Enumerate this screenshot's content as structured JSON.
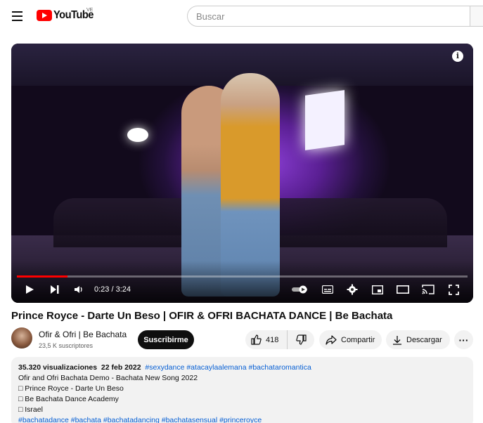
{
  "header": {
    "logo_text": "YouTube",
    "country_code": "VE",
    "search_placeholder": "Buscar"
  },
  "player": {
    "current_time": "0:23",
    "duration": "3:24",
    "time_display": "0:23 / 3:24",
    "progress_fraction": 0.113,
    "info_glyph": "i"
  },
  "video": {
    "title": "Prince Royce - Darte Un Beso | OFIR & OFRI BACHATA DANCE | Be Bachata"
  },
  "channel": {
    "name": "Ofir & Ofri | Be Bachata",
    "subscribers": "23,5 K suscriptores",
    "subscribe_label": "Suscribirme"
  },
  "actions": {
    "like_count": "418",
    "share_label": "Compartir",
    "download_label": "Descargar",
    "more_glyph": "···"
  },
  "description": {
    "views": "35.320 visualizaciones",
    "date": "22 feb 2022",
    "tags": "#sexydance #atacaylaalemana #bachataromantica",
    "lines": [
      "Ofir and Ofri Bachata Demo - Bachata New Song 2022",
      "□ Prince Royce - Darte Un Beso",
      "□ Be Bachata Dance Academy",
      "□ Israel"
    ],
    "bottom_tags": "#bachatadance  #bachata #bachatadancing  #bachatasensual #princeroyce"
  },
  "icons": [
    "menu-icon",
    "youtube-logo-icon",
    "info-icon",
    "play-icon",
    "next-icon",
    "volume-icon",
    "autoplay-toggle-icon",
    "subtitles-icon",
    "settings-icon",
    "miniplayer-icon",
    "theater-icon",
    "cast-icon",
    "fullscreen-icon",
    "like-icon",
    "dislike-icon",
    "share-icon",
    "download-icon",
    "more-icon"
  ],
  "colors": {
    "brand_red": "#ff0000",
    "link_blue": "#065fd4",
    "pill_bg": "#f2f2f2",
    "subscribe_bg": "#0f0f0f"
  }
}
